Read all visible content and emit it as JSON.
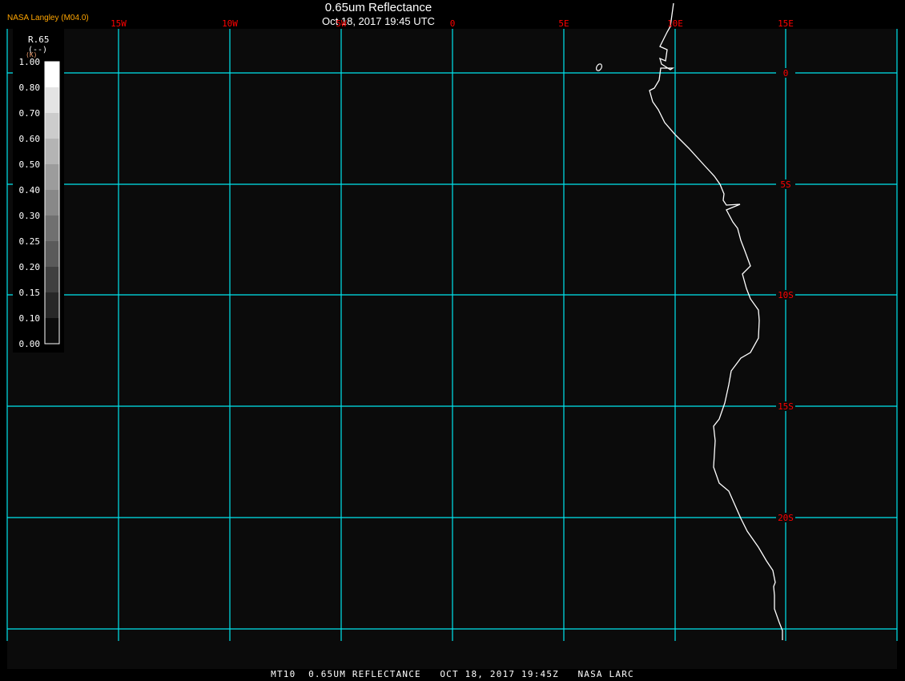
{
  "header": {
    "title": "0.65um Reflectance",
    "subtitle": "Oct 18, 2017 19:45 UTC",
    "producer": "NASA Langley (M04.0)"
  },
  "footer": {
    "caption": "MT10  0.65UM REFLECTANCE   OCT 18, 2017 19:45Z   NASA LARC"
  },
  "legend": {
    "variable": "R.65",
    "units": "(--)",
    "units_overlay": "(K)",
    "tick_labels": [
      "1.00",
      "0.80",
      "0.70",
      "0.60",
      "0.50",
      "0.40",
      "0.30",
      "0.25",
      "0.20",
      "0.15",
      "0.10",
      "0.00"
    ],
    "bin_colors": [
      "#ffffff",
      "#e4e4e4",
      "#cccccc",
      "#b4b4b4",
      "#9c9c9c",
      "#888888",
      "#707070",
      "#5a5a5a",
      "#404040",
      "#282828",
      "#0c0c0c"
    ]
  },
  "map": {
    "longitude_labels": [
      "15W",
      "10W",
      "5W",
      "0",
      "5E",
      "10E",
      "15E"
    ],
    "latitude_labels": [
      "0",
      "5S",
      "10S",
      "15S",
      "20S"
    ],
    "grid_color": "#00e5ee",
    "label_color": "#ff0000",
    "coastline_color": "#ffffff",
    "background_color": "#0b0b0b"
  }
}
